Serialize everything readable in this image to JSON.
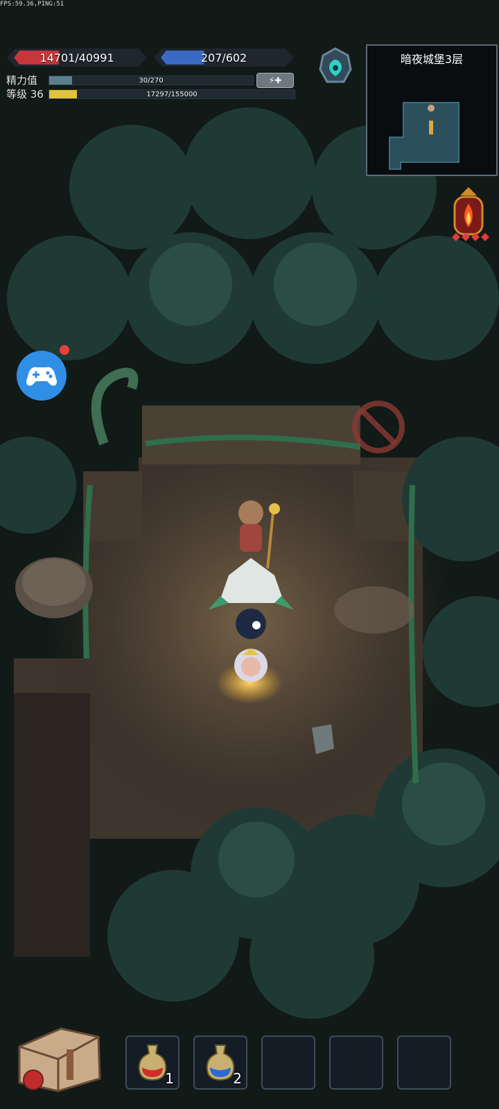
{
  "debug": {
    "fps_text": "FPS:59.36,PING:51"
  },
  "stats": {
    "hp": {
      "current": 14701,
      "max": 40991,
      "text": "14701/40991",
      "color": "#c8353a"
    },
    "mp": {
      "current": 207,
      "max": 602,
      "text": "207/602",
      "color": "#3a6bc4"
    },
    "energy": {
      "label": "精力值",
      "current": 30,
      "max": 270,
      "text": "30/270",
      "color": "#5c7f8e",
      "button_icon": "⚡✚"
    },
    "level": {
      "label": "等级 36",
      "exp_current": 17297,
      "exp_max": 155000,
      "text": "17297/155000",
      "color": "#e3c33a"
    }
  },
  "minimap": {
    "title": "暗夜城堡3层"
  },
  "quickbar": {
    "slots": [
      {
        "item": "red-potion",
        "count": "1"
      },
      {
        "item": "blue-potion",
        "count": "2"
      },
      {
        "item": "",
        "count": ""
      },
      {
        "item": "",
        "count": ""
      },
      {
        "item": "",
        "count": ""
      }
    ]
  },
  "icons": {
    "portal": "portal-rune-icon",
    "lantern": "fire-lantern-icon",
    "gamepad": "gamepad-icon",
    "bag": "backpack-icon"
  }
}
